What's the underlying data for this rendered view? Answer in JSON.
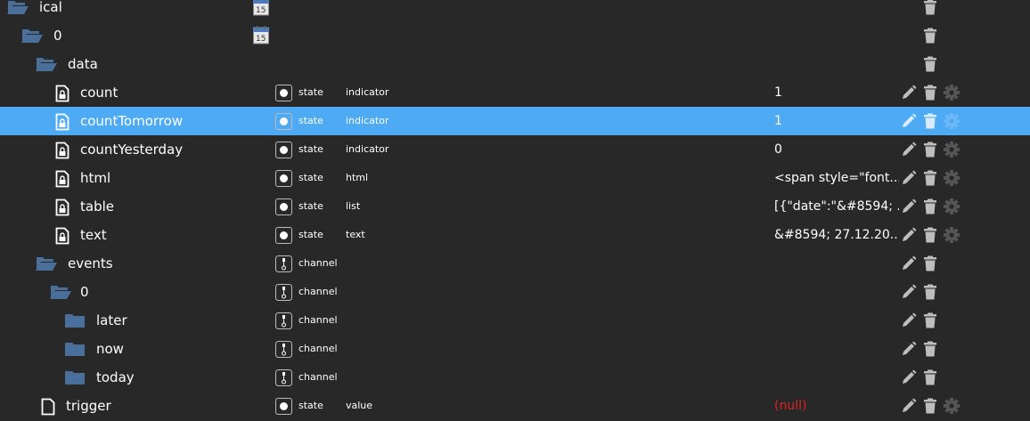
{
  "colors": {
    "background": "#282828",
    "selected": "#4daaf3",
    "folder": "#4a6f9a",
    "null_value": "#e02020",
    "icon": "#bdbdbd",
    "gear": "#555555"
  },
  "rows": [
    {
      "name": "ical",
      "level": 0,
      "icon": "folder-open-icon",
      "calendar": true,
      "actions": [
        "delete"
      ]
    },
    {
      "name": "0",
      "level": 1,
      "icon": "folder-open-icon",
      "calendar": true,
      "actions": [
        "delete"
      ]
    },
    {
      "name": "data",
      "level": 2,
      "icon": "folder-open-icon",
      "actions": [
        "delete"
      ]
    },
    {
      "name": "count",
      "level": 3,
      "icon": "locked-file-icon",
      "type_icon": "state-icon",
      "type": "state",
      "role": "indicator",
      "value": "1",
      "actions": [
        "edit",
        "delete",
        "settings"
      ]
    },
    {
      "name": "countTomorrow",
      "level": 3,
      "icon": "locked-file-icon",
      "type_icon": "state-icon",
      "type": "state",
      "role": "indicator",
      "value": "1",
      "selected": true,
      "actions": [
        "edit",
        "delete",
        "settings"
      ]
    },
    {
      "name": "countYesterday",
      "level": 3,
      "icon": "locked-file-icon",
      "type_icon": "state-icon",
      "type": "state",
      "role": "indicator",
      "value": "0",
      "actions": [
        "edit",
        "delete",
        "settings"
      ]
    },
    {
      "name": "html",
      "level": 3,
      "icon": "locked-file-icon",
      "type_icon": "state-icon",
      "type": "state",
      "role": "html",
      "value": "<span style=\"font...",
      "actions": [
        "edit",
        "delete",
        "settings"
      ]
    },
    {
      "name": "table",
      "level": 3,
      "icon": "locked-file-icon",
      "type_icon": "state-icon",
      "type": "state",
      "role": "list",
      "value": "[{\"date\":\"&#8594; ...",
      "actions": [
        "edit",
        "delete",
        "settings"
      ]
    },
    {
      "name": "text",
      "level": 3,
      "icon": "locked-file-icon",
      "type_icon": "state-icon",
      "type": "state",
      "role": "text",
      "value": "&#8594; 27.12.20...",
      "actions": [
        "edit",
        "delete",
        "settings"
      ]
    },
    {
      "name": "events",
      "level": 2,
      "icon": "folder-open-icon",
      "type_icon": "channel-icon",
      "type": "channel",
      "actions": [
        "edit",
        "delete"
      ]
    },
    {
      "name": "0",
      "level": 3,
      "icon": "folder-open-icon",
      "type_icon": "channel-icon",
      "type": "channel",
      "actions": [
        "edit",
        "delete"
      ]
    },
    {
      "name": "later",
      "level": 4,
      "icon": "folder-closed-icon",
      "type_icon": "channel-icon",
      "type": "channel",
      "actions": [
        "edit",
        "delete"
      ]
    },
    {
      "name": "now",
      "level": 4,
      "icon": "folder-closed-icon",
      "type_icon": "channel-icon",
      "type": "channel",
      "actions": [
        "edit",
        "delete"
      ]
    },
    {
      "name": "today",
      "level": 4,
      "icon": "folder-closed-icon",
      "type_icon": "channel-icon",
      "type": "channel",
      "actions": [
        "edit",
        "delete"
      ]
    },
    {
      "name": "trigger",
      "level": 2,
      "icon": "file-icon",
      "type_icon": "state-icon",
      "type": "state",
      "role": "value",
      "value": "(null)",
      "null": true,
      "actions": [
        "edit",
        "delete",
        "settings"
      ]
    }
  ]
}
